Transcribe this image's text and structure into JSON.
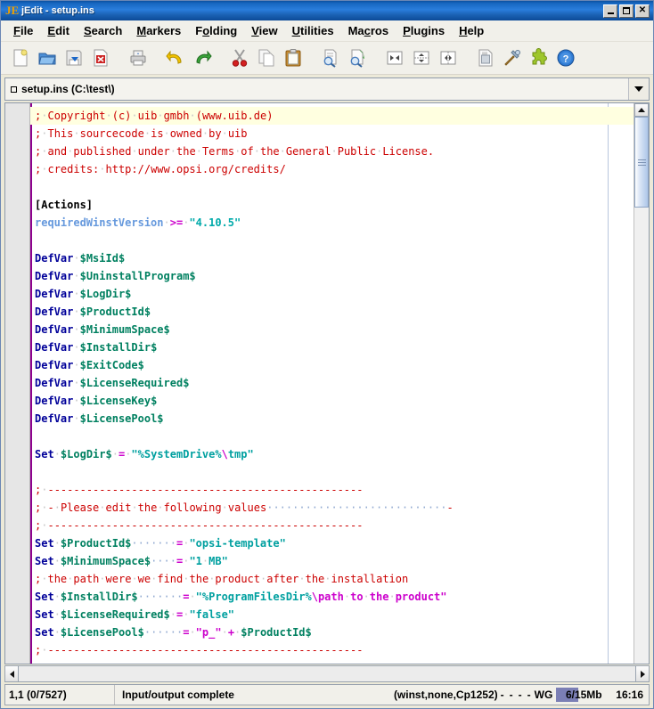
{
  "window": {
    "title": "jEdit - setup.ins",
    "icon": "jedit-logo-icon",
    "minimize_label": "_",
    "maximize_label": "□",
    "close_label": "✕"
  },
  "menubar": {
    "items": [
      {
        "label": "File",
        "mnemonic": "F"
      },
      {
        "label": "Edit",
        "mnemonic": "E"
      },
      {
        "label": "Search",
        "mnemonic": "S"
      },
      {
        "label": "Markers",
        "mnemonic": "M"
      },
      {
        "label": "Folding",
        "mnemonic": "o"
      },
      {
        "label": "View",
        "mnemonic": "V"
      },
      {
        "label": "Utilities",
        "mnemonic": "U"
      },
      {
        "label": "Macros",
        "mnemonic": "c"
      },
      {
        "label": "Plugins",
        "mnemonic": "P"
      },
      {
        "label": "Help",
        "mnemonic": "H"
      }
    ]
  },
  "toolbar": {
    "buttons": [
      {
        "name": "new-file-icon",
        "tip": "New File"
      },
      {
        "name": "open-file-icon",
        "tip": "Open File"
      },
      {
        "name": "save-file-icon",
        "tip": "Save"
      },
      {
        "name": "close-file-icon",
        "tip": "Close Buffer"
      },
      {
        "name": "print-icon",
        "tip": "Print"
      },
      {
        "name": "undo-icon",
        "tip": "Undo"
      },
      {
        "name": "redo-icon",
        "tip": "Redo"
      },
      {
        "name": "cut-icon",
        "tip": "Cut"
      },
      {
        "name": "copy-icon",
        "tip": "Copy"
      },
      {
        "name": "paste-icon",
        "tip": "Paste"
      },
      {
        "name": "find-icon",
        "tip": "Find"
      },
      {
        "name": "find-next-icon",
        "tip": "Find Next"
      },
      {
        "name": "unsplit-icon",
        "tip": "Unsplit"
      },
      {
        "name": "split-horizontal-icon",
        "tip": "Split Horizontally"
      },
      {
        "name": "split-vertical-icon",
        "tip": "Split Vertically"
      },
      {
        "name": "log-icon",
        "tip": "Activity Log"
      },
      {
        "name": "options-icon",
        "tip": "Global Options"
      },
      {
        "name": "plugin-manager-icon",
        "tip": "Plugin Manager"
      },
      {
        "name": "help-icon",
        "tip": "Help"
      }
    ]
  },
  "buffer": {
    "label": "setup.ins (C:\\test\\)",
    "dropdown_icon": "chevron-down-icon"
  },
  "editor": {
    "lines": [
      {
        "caret": true,
        "tokens": [
          {
            "t": ";",
            "c": "c-comment"
          },
          {
            "t": "·",
            "c": "sp"
          },
          {
            "t": "Copyright",
            "c": "c-comment"
          },
          {
            "t": "·",
            "c": "sp"
          },
          {
            "t": "(c)",
            "c": "c-comment"
          },
          {
            "t": "·",
            "c": "sp"
          },
          {
            "t": "uib",
            "c": "c-comment"
          },
          {
            "t": "·",
            "c": "sp"
          },
          {
            "t": "gmbh",
            "c": "c-comment"
          },
          {
            "t": "·",
            "c": "sp"
          },
          {
            "t": "(www.uib.de)",
            "c": "c-comment"
          }
        ]
      },
      {
        "tokens": [
          {
            "t": ";",
            "c": "c-comment"
          },
          {
            "t": "·",
            "c": "sp"
          },
          {
            "t": "This",
            "c": "c-comment"
          },
          {
            "t": "·",
            "c": "sp"
          },
          {
            "t": "sourcecode",
            "c": "c-comment"
          },
          {
            "t": "·",
            "c": "sp"
          },
          {
            "t": "is",
            "c": "c-comment"
          },
          {
            "t": "·",
            "c": "sp"
          },
          {
            "t": "owned",
            "c": "c-comment"
          },
          {
            "t": "·",
            "c": "sp"
          },
          {
            "t": "by",
            "c": "c-comment"
          },
          {
            "t": "·",
            "c": "sp"
          },
          {
            "t": "uib",
            "c": "c-comment"
          }
        ]
      },
      {
        "tokens": [
          {
            "t": ";",
            "c": "c-comment"
          },
          {
            "t": "·",
            "c": "sp"
          },
          {
            "t": "and",
            "c": "c-comment"
          },
          {
            "t": "·",
            "c": "sp"
          },
          {
            "t": "published",
            "c": "c-comment"
          },
          {
            "t": "·",
            "c": "sp"
          },
          {
            "t": "under",
            "c": "c-comment"
          },
          {
            "t": "·",
            "c": "sp"
          },
          {
            "t": "the",
            "c": "c-comment"
          },
          {
            "t": "·",
            "c": "sp"
          },
          {
            "t": "Terms",
            "c": "c-comment"
          },
          {
            "t": "·",
            "c": "sp"
          },
          {
            "t": "of",
            "c": "c-comment"
          },
          {
            "t": "·",
            "c": "sp"
          },
          {
            "t": "the",
            "c": "c-comment"
          },
          {
            "t": "·",
            "c": "sp"
          },
          {
            "t": "General",
            "c": "c-comment"
          },
          {
            "t": "·",
            "c": "sp"
          },
          {
            "t": "Public",
            "c": "c-comment"
          },
          {
            "t": "·",
            "c": "sp"
          },
          {
            "t": "License.",
            "c": "c-comment"
          }
        ]
      },
      {
        "tokens": [
          {
            "t": ";",
            "c": "c-comment"
          },
          {
            "t": "·",
            "c": "sp"
          },
          {
            "t": "credits:",
            "c": "c-comment"
          },
          {
            "t": "·",
            "c": "sp"
          },
          {
            "t": "http://www.opsi.org/credits/",
            "c": "c-comment"
          }
        ]
      },
      {
        "tokens": []
      },
      {
        "tokens": [
          {
            "t": "[Actions]",
            "c": "c-label"
          }
        ]
      },
      {
        "tokens": [
          {
            "t": "requiredWinstVersion",
            "c": "c-func"
          },
          {
            "t": "·",
            "c": "sp"
          },
          {
            "t": ">=",
            "c": "c-op"
          },
          {
            "t": "·",
            "c": "sp"
          },
          {
            "t": "\"4.10.5\"",
            "c": "c-literal"
          }
        ]
      },
      {
        "tokens": []
      },
      {
        "tokens": [
          {
            "t": "DefVar",
            "c": "c-keyword"
          },
          {
            "t": "·",
            "c": "sp"
          },
          {
            "t": "$MsiId$",
            "c": "c-var"
          }
        ]
      },
      {
        "tokens": [
          {
            "t": "DefVar",
            "c": "c-keyword"
          },
          {
            "t": "·",
            "c": "sp"
          },
          {
            "t": "$UninstallProgram$",
            "c": "c-var"
          }
        ]
      },
      {
        "tokens": [
          {
            "t": "DefVar",
            "c": "c-keyword"
          },
          {
            "t": "·",
            "c": "sp"
          },
          {
            "t": "$LogDir$",
            "c": "c-var"
          }
        ]
      },
      {
        "tokens": [
          {
            "t": "DefVar",
            "c": "c-keyword"
          },
          {
            "t": "·",
            "c": "sp"
          },
          {
            "t": "$ProductId$",
            "c": "c-var"
          }
        ]
      },
      {
        "tokens": [
          {
            "t": "DefVar",
            "c": "c-keyword"
          },
          {
            "t": "·",
            "c": "sp"
          },
          {
            "t": "$MinimumSpace$",
            "c": "c-var"
          }
        ]
      },
      {
        "tokens": [
          {
            "t": "DefVar",
            "c": "c-keyword"
          },
          {
            "t": "·",
            "c": "sp"
          },
          {
            "t": "$InstallDir$",
            "c": "c-var"
          }
        ]
      },
      {
        "tokens": [
          {
            "t": "DefVar",
            "c": "c-keyword"
          },
          {
            "t": "·",
            "c": "sp"
          },
          {
            "t": "$ExitCode$",
            "c": "c-var"
          }
        ]
      },
      {
        "tokens": [
          {
            "t": "DefVar",
            "c": "c-keyword"
          },
          {
            "t": "·",
            "c": "sp"
          },
          {
            "t": "$LicenseRequired$",
            "c": "c-var"
          }
        ]
      },
      {
        "tokens": [
          {
            "t": "DefVar",
            "c": "c-keyword"
          },
          {
            "t": "·",
            "c": "sp"
          },
          {
            "t": "$LicenseKey$",
            "c": "c-var"
          }
        ]
      },
      {
        "tokens": [
          {
            "t": "DefVar",
            "c": "c-keyword"
          },
          {
            "t": "·",
            "c": "sp"
          },
          {
            "t": "$LicensePool$",
            "c": "c-var"
          }
        ]
      },
      {
        "tokens": []
      },
      {
        "tokens": [
          {
            "t": "Set",
            "c": "c-keyword"
          },
          {
            "t": "·",
            "c": "sp"
          },
          {
            "t": "$LogDir$",
            "c": "c-var"
          },
          {
            "t": "·",
            "c": "sp"
          },
          {
            "t": "=",
            "c": "c-op"
          },
          {
            "t": "·",
            "c": "sp"
          },
          {
            "t": "\"%SystemDrive%",
            "c": "c-string"
          },
          {
            "t": "\\",
            "c": "c-op"
          },
          {
            "t": "tmp\"",
            "c": "c-string"
          }
        ]
      },
      {
        "tokens": []
      },
      {
        "tokens": [
          {
            "t": ";",
            "c": "c-comment"
          },
          {
            "t": "·",
            "c": "sp"
          },
          {
            "t": "-------------------------------------------------",
            "c": "c-comment"
          }
        ]
      },
      {
        "tokens": [
          {
            "t": ";",
            "c": "c-comment"
          },
          {
            "t": "·",
            "c": "sp"
          },
          {
            "t": "-",
            "c": "c-comment"
          },
          {
            "t": "·",
            "c": "sp"
          },
          {
            "t": "Please",
            "c": "c-comment"
          },
          {
            "t": "·",
            "c": "sp"
          },
          {
            "t": "edit",
            "c": "c-comment"
          },
          {
            "t": "·",
            "c": "sp"
          },
          {
            "t": "the",
            "c": "c-comment"
          },
          {
            "t": "·",
            "c": "sp"
          },
          {
            "t": "following",
            "c": "c-comment"
          },
          {
            "t": "·",
            "c": "sp"
          },
          {
            "t": "values",
            "c": "c-comment"
          },
          {
            "t": "····························",
            "c": "c-dots"
          },
          {
            "t": "-",
            "c": "c-comment"
          }
        ]
      },
      {
        "tokens": [
          {
            "t": ";",
            "c": "c-comment"
          },
          {
            "t": "·",
            "c": "sp"
          },
          {
            "t": "-------------------------------------------------",
            "c": "c-comment"
          }
        ]
      },
      {
        "tokens": [
          {
            "t": "Set",
            "c": "c-keyword"
          },
          {
            "t": "·",
            "c": "sp"
          },
          {
            "t": "$ProductId$",
            "c": "c-var"
          },
          {
            "t": "·······",
            "c": "c-dots"
          },
          {
            "t": "=",
            "c": "c-op"
          },
          {
            "t": "·",
            "c": "sp"
          },
          {
            "t": "\"opsi-template\"",
            "c": "c-string"
          }
        ]
      },
      {
        "tokens": [
          {
            "t": "Set",
            "c": "c-keyword"
          },
          {
            "t": "·",
            "c": "sp"
          },
          {
            "t": "$MinimumSpace$",
            "c": "c-var"
          },
          {
            "t": "····",
            "c": "c-dots"
          },
          {
            "t": "=",
            "c": "c-op"
          },
          {
            "t": "·",
            "c": "sp"
          },
          {
            "t": "\"1",
            "c": "c-string"
          },
          {
            "t": "·",
            "c": "sp"
          },
          {
            "t": "MB\"",
            "c": "c-string"
          }
        ]
      },
      {
        "tokens": [
          {
            "t": ";",
            "c": "c-comment"
          },
          {
            "t": "·",
            "c": "sp"
          },
          {
            "t": "the",
            "c": "c-comment"
          },
          {
            "t": "·",
            "c": "sp"
          },
          {
            "t": "path",
            "c": "c-comment"
          },
          {
            "t": "·",
            "c": "sp"
          },
          {
            "t": "were",
            "c": "c-comment"
          },
          {
            "t": "·",
            "c": "sp"
          },
          {
            "t": "we",
            "c": "c-comment"
          },
          {
            "t": "·",
            "c": "sp"
          },
          {
            "t": "find",
            "c": "c-comment"
          },
          {
            "t": "·",
            "c": "sp"
          },
          {
            "t": "the",
            "c": "c-comment"
          },
          {
            "t": "·",
            "c": "sp"
          },
          {
            "t": "product",
            "c": "c-comment"
          },
          {
            "t": "·",
            "c": "sp"
          },
          {
            "t": "after",
            "c": "c-comment"
          },
          {
            "t": "·",
            "c": "sp"
          },
          {
            "t": "the",
            "c": "c-comment"
          },
          {
            "t": "·",
            "c": "sp"
          },
          {
            "t": "installation",
            "c": "c-comment"
          }
        ]
      },
      {
        "tokens": [
          {
            "t": "Set",
            "c": "c-keyword"
          },
          {
            "t": "·",
            "c": "sp"
          },
          {
            "t": "$InstallDir$",
            "c": "c-var"
          },
          {
            "t": "·······",
            "c": "c-dots"
          },
          {
            "t": "=",
            "c": "c-op"
          },
          {
            "t": "·",
            "c": "sp"
          },
          {
            "t": "\"%ProgramFilesDir%",
            "c": "c-string"
          },
          {
            "t": "\\",
            "c": "c-op"
          },
          {
            "t": "path",
            "c": "c-op"
          },
          {
            "t": "·",
            "c": "sp"
          },
          {
            "t": "to",
            "c": "c-op"
          },
          {
            "t": "·",
            "c": "sp"
          },
          {
            "t": "the",
            "c": "c-op"
          },
          {
            "t": "·",
            "c": "sp"
          },
          {
            "t": "product\"",
            "c": "c-op"
          }
        ]
      },
      {
        "tokens": [
          {
            "t": "Set",
            "c": "c-keyword"
          },
          {
            "t": "·",
            "c": "sp"
          },
          {
            "t": "$LicenseRequired$",
            "c": "c-var"
          },
          {
            "t": "·",
            "c": "sp"
          },
          {
            "t": "=",
            "c": "c-op"
          },
          {
            "t": "·",
            "c": "sp"
          },
          {
            "t": "\"false\"",
            "c": "c-string"
          }
        ]
      },
      {
        "tokens": [
          {
            "t": "Set",
            "c": "c-keyword"
          },
          {
            "t": "·",
            "c": "sp"
          },
          {
            "t": "$LicensePool$",
            "c": "c-var"
          },
          {
            "t": "······",
            "c": "c-dots"
          },
          {
            "t": "=",
            "c": "c-op"
          },
          {
            "t": "·",
            "c": "sp"
          },
          {
            "t": "\"p_\"",
            "c": "c-op"
          },
          {
            "t": "·",
            "c": "sp"
          },
          {
            "t": "+",
            "c": "c-op"
          },
          {
            "t": "·",
            "c": "sp"
          },
          {
            "t": "$ProductId$",
            "c": "c-var"
          }
        ]
      },
      {
        "tokens": [
          {
            "t": ";",
            "c": "c-comment"
          },
          {
            "t": "·",
            "c": "sp"
          },
          {
            "t": "-------------------------------------------------",
            "c": "c-comment"
          }
        ]
      }
    ]
  },
  "statusbar": {
    "caret": "1,1 (0/7527)",
    "message": "Input/output complete",
    "mode": "(winst,none,Cp1252)",
    "flags": [
      "-",
      "-",
      "-",
      "-"
    ],
    "wrap": "WG",
    "memory": "6/15Mb",
    "memory_percent": 40,
    "memory_fill_color": "#7b7fb5",
    "clock": "16:16"
  },
  "scrollbars": {
    "vertical": {
      "up_icon": "triangle-up-icon",
      "down_icon": "triangle-down-icon"
    },
    "horizontal": {
      "left_icon": "triangle-left-icon",
      "right_icon": "triangle-right-icon"
    }
  }
}
